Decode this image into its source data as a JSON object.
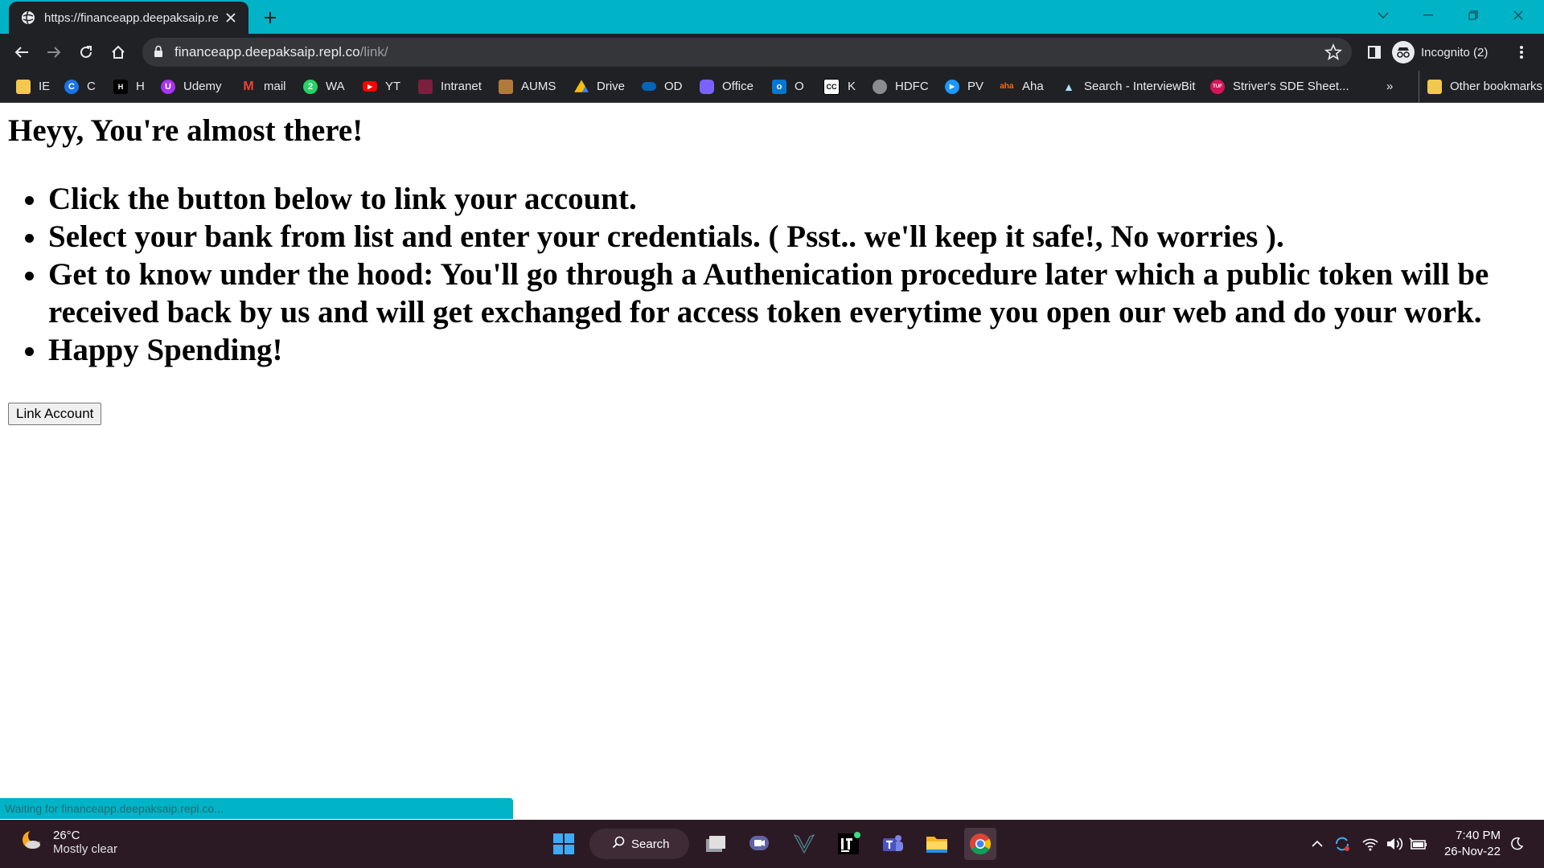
{
  "browser": {
    "tab_title": "https://financeapp.deepaksaip.re",
    "url_host": "financeapp.deepaksaip.repl.co",
    "url_path": "/link/",
    "profile_label": "Incognito (2)",
    "status_text": "Waiting for financeapp.deepaksaip.repl.co...",
    "accent_color": "#00b3c7",
    "bookmarks": [
      {
        "label": "IE",
        "icon": "folder-icon"
      },
      {
        "label": "C",
        "icon": "c-icon"
      },
      {
        "label": "H",
        "icon": "h-icon"
      },
      {
        "label": "Udemy",
        "icon": "udemy-icon"
      },
      {
        "label": "mail",
        "icon": "gmail-icon"
      },
      {
        "label": "WA",
        "icon": "whatsapp-icon"
      },
      {
        "label": "YT",
        "icon": "youtube-icon"
      },
      {
        "label": "Intranet",
        "icon": "intranet-icon"
      },
      {
        "label": "AUMS",
        "icon": "aums-icon"
      },
      {
        "label": "Drive",
        "icon": "drive-icon"
      },
      {
        "label": "OD",
        "icon": "onedrive-icon"
      },
      {
        "label": "Office",
        "icon": "office-icon"
      },
      {
        "label": "O",
        "icon": "outlook-icon"
      },
      {
        "label": "K",
        "icon": "k-icon"
      },
      {
        "label": "HDFC",
        "icon": "globe-icon"
      },
      {
        "label": "PV",
        "icon": "primevideo-icon"
      },
      {
        "label": "Aha",
        "icon": "aha-icon"
      },
      {
        "label": "Search - InterviewBit",
        "icon": "interviewbit-icon"
      },
      {
        "label": "Striver's SDE Sheet...",
        "icon": "tuf-icon"
      }
    ],
    "overflow_label": "»",
    "other_bookmarks_label": "Other bookmarks"
  },
  "page": {
    "heading": "Heyy, You're almost there!",
    "steps": [
      "Click the button below to link your account.",
      "Select your bank from list and enter your credentials. ( Psst.. we'll keep it safe!, No worries ).",
      "Get to know under the hood: You'll go through a Authenication procedure later which a public token will be received back by us and will get exchanged for access token everytime you open our web and do your work.",
      "Happy Spending!"
    ],
    "link_button_label": "Link Account"
  },
  "taskbar": {
    "temperature": "26°C",
    "weather": "Mostly clear",
    "search_label": "Search",
    "time": "7:40 PM",
    "date": "26-Nov-22"
  }
}
